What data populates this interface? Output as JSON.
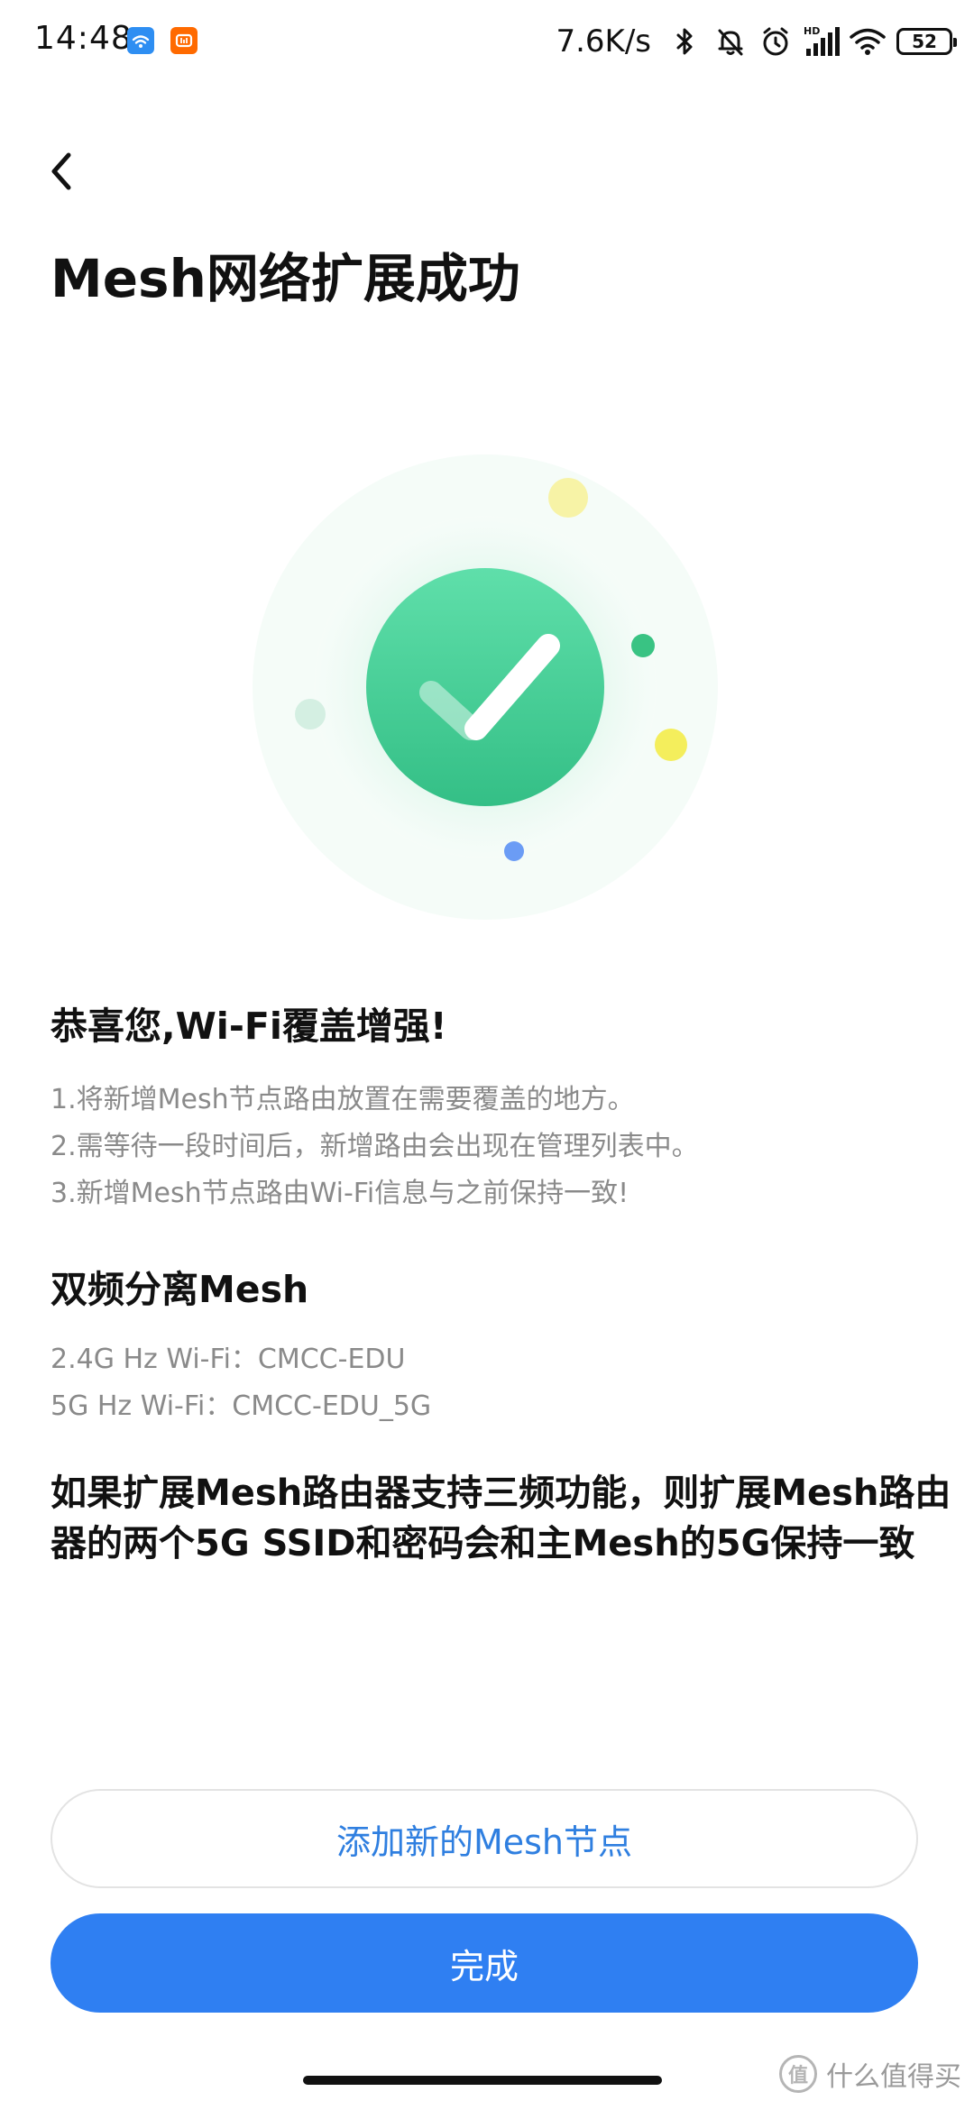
{
  "status_bar": {
    "time": "14:48",
    "net_speed": "7.6K/s",
    "battery": "52"
  },
  "header": {
    "title": "Mesh网络扩展成功"
  },
  "tips": {
    "heading": "恭喜您,Wi-Fi覆盖增强!",
    "items": [
      "1.将新增Mesh节点路由放置在需要覆盖的地方。",
      "2.需等待一段时间后，新增路由会出现在管理列表中。",
      "3.新增Mesh节点路由Wi-Fi信息与之前保持一致!"
    ]
  },
  "dual_band": {
    "heading": "双频分离Mesh",
    "lines": [
      "2.4G Hz Wi-Fi：CMCC-EDU",
      "5G Hz Wi-Fi：CMCC-EDU_5G"
    ]
  },
  "tri_band_note": "如果扩展Mesh路由器支持三频功能，则扩展Mesh路由器的两个5G SSID和密码会和主Mesh的5G保持一致",
  "buttons": {
    "add_label": "添加新的Mesh节点",
    "done_label": "完成"
  },
  "watermark": {
    "badge": "值",
    "text": "什么值得买"
  },
  "colors": {
    "primary": "#2f7ff2",
    "success": "#3fc48c"
  },
  "icons": {
    "back": "chevron-left-icon",
    "success": "check-circle-icon"
  }
}
